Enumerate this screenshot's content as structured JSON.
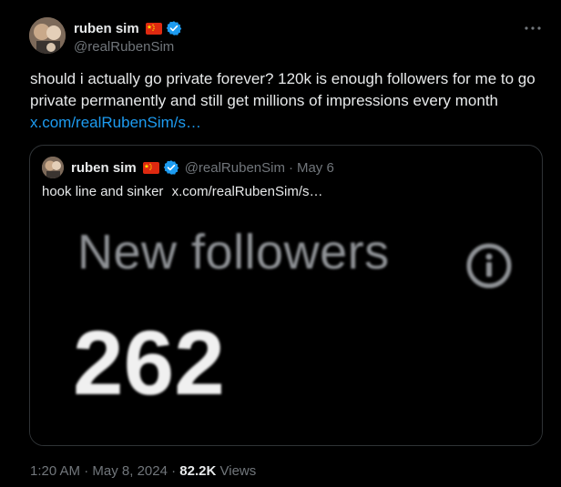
{
  "tweet": {
    "author": {
      "name": "ruben sim",
      "handle": "@realRubenSim"
    },
    "more_icon": "more-horizontal-icon",
    "text": "should i actually go private forever? 120k is enough followers for me to go private permanently and still get millions of impressions every month",
    "link": "x.com/realRubenSim/s…",
    "quoted": {
      "author": {
        "name": "ruben sim",
        "handle": "@realRubenSim"
      },
      "separator": "·",
      "date": "May 6",
      "text": "hook line and sinker",
      "link": "x.com/realRubenSim/s…",
      "media": {
        "heading": "New followers",
        "value": "262",
        "info_icon": "info-icon"
      }
    },
    "meta": {
      "time": "1:20 AM",
      "separator": "·",
      "date": "May 8, 2024",
      "views_count": "82.2K",
      "views_label": "Views"
    }
  },
  "colors": {
    "background": "#000000",
    "text": "#e7e9ea",
    "secondary": "#71767b",
    "link": "#1d9bf0",
    "border": "#2f3336",
    "verified": "#1d9bf0",
    "flag_red": "#de2910",
    "flag_star": "#ffde00"
  }
}
